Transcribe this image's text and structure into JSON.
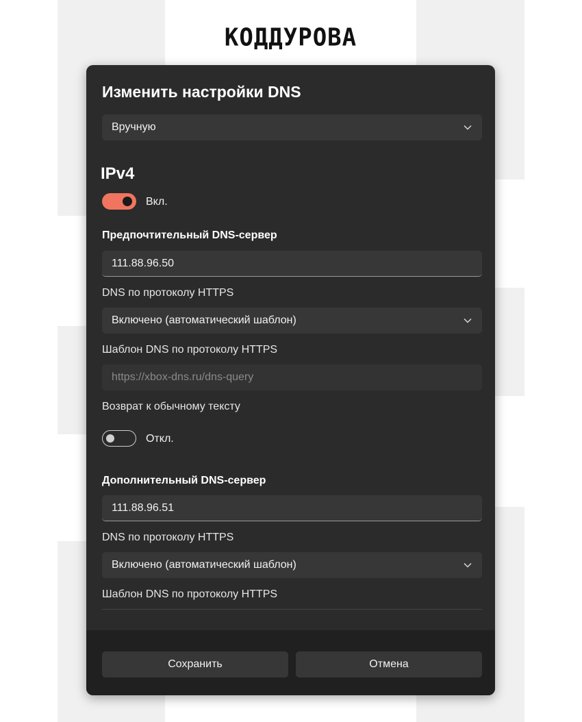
{
  "logo": {
    "text": "КОДДУРОВА"
  },
  "dialog": {
    "title": "Изменить настройки DNS",
    "mode_select": {
      "value": "Вручную",
      "icon": "chevron-down-icon"
    },
    "ipv4": {
      "heading": "IPv4",
      "toggle": {
        "state": "on",
        "label": "Вкл."
      },
      "preferred": {
        "label": "Предпочтительный DNS-сервер",
        "value": "111.88.96.50",
        "doh_label": "DNS по протоколу HTTPS",
        "doh_select": "Включено (автоматический шаблон)",
        "template_label": "Шаблон DNS по протоколу HTTPS",
        "template_placeholder": "https://xbox-dns.ru/dns-query",
        "fallback_label": "Возврат к обычному тексту",
        "fallback_toggle": {
          "state": "off",
          "label": "Откл."
        }
      },
      "alternate": {
        "label": "Дополнительный DNS-сервер",
        "value": "111.88.96.51",
        "doh_label": "DNS по протоколу HTTPS",
        "doh_select": "Включено (автоматический шаблон)",
        "template_label": "Шаблон DNS по протоколу HTTPS"
      }
    },
    "buttons": {
      "save": "Сохранить",
      "cancel": "Отмена"
    }
  },
  "colors": {
    "dialog_bg": "#2b2b2b",
    "control_bg": "#373737",
    "footer_bg": "#202020",
    "accent": "#ef7560"
  }
}
